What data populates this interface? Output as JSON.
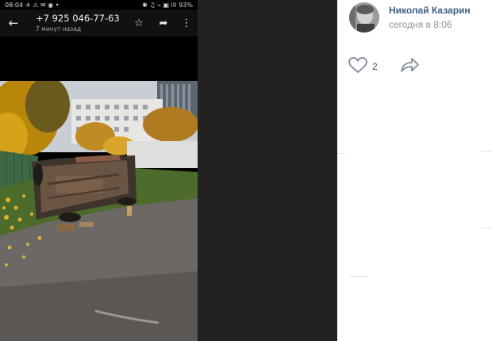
{
  "phone": {
    "status": {
      "time": "08:04",
      "icons_left": "✈ ⚠ ✉ ◉ •",
      "icons_right": "✱ ♫ ⌁ ▣ ill",
      "battery": "93%"
    },
    "contact": {
      "title": "+7 925 046-77-63",
      "subtitle": "7 минут назад"
    },
    "icons": {
      "back": "arrow-back-icon",
      "star": "star-icon",
      "share": "share-icon",
      "more": "more-vert-icon"
    }
  },
  "post": {
    "author": "Николай Казарин",
    "date": "сегодня в 8:06",
    "likes": "2",
    "colors": {
      "author": "#3e5e82",
      "meta": "#939393",
      "icon": "#828a99"
    }
  }
}
